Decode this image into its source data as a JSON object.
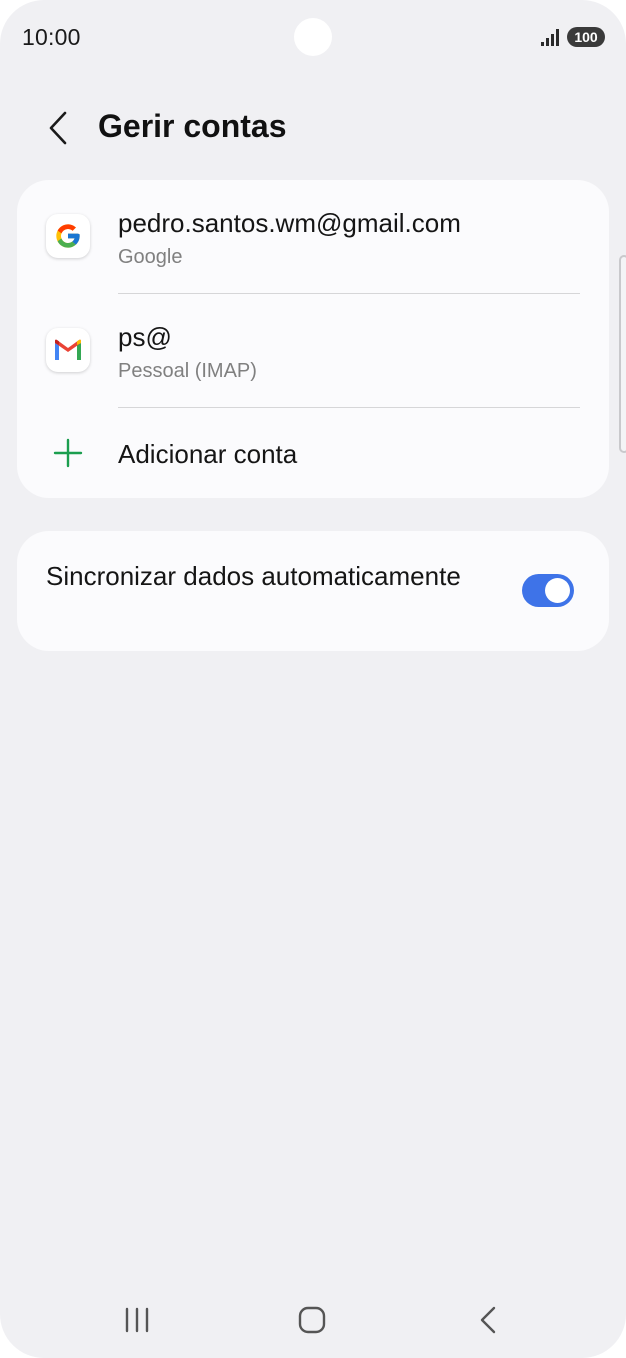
{
  "status_bar": {
    "time": "10:00",
    "battery": "100",
    "icons": [
      "signal-icon",
      "battery-icon"
    ]
  },
  "header": {
    "back_icon": "chevron-left-icon",
    "title": "Gerir contas"
  },
  "accounts": [
    {
      "name": "pedro.santos.wm@gmail.com",
      "type": "Google",
      "icon": "google-icon"
    },
    {
      "name": "ps@",
      "type": "Pessoal (IMAP)",
      "icon": "gmail-icon"
    }
  ],
  "add_account": {
    "label": "Adicionar conta",
    "icon": "plus-icon"
  },
  "sync": {
    "label": "Sincronizar dados automaticamente",
    "enabled": true
  },
  "colors": {
    "accent": "#3e73e8",
    "plus": "#1b9e4f",
    "background": "#f0f0f3",
    "card": "#fbfbfd"
  },
  "nav_bar": {
    "icons": [
      "recent-apps-icon",
      "home-icon",
      "back-icon"
    ]
  }
}
